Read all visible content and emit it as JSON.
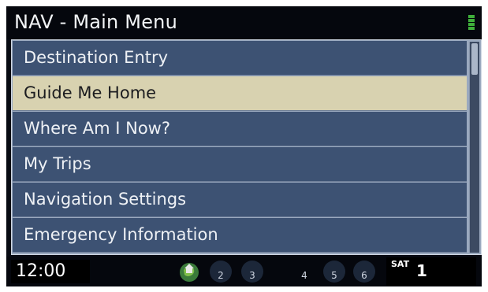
{
  "header": {
    "title": "NAV - Main Menu",
    "status_icon": "signal-strength-icon"
  },
  "menu": {
    "items": [
      {
        "label": "Destination Entry",
        "selected": false
      },
      {
        "label": "Guide Me Home",
        "selected": true
      },
      {
        "label": "Where Am I Now?",
        "selected": false
      },
      {
        "label": "My Trips",
        "selected": false
      },
      {
        "label": "Navigation Settings",
        "selected": false
      },
      {
        "label": "Emergency Information",
        "selected": false
      }
    ]
  },
  "statusbar": {
    "time": "12:00",
    "presets": [
      "2",
      "3",
      "4",
      "5",
      "6"
    ],
    "source_label": "SAT",
    "channel": "1"
  },
  "colors": {
    "item_bg": "#3d5273",
    "selected_bg": "#d8d2b0",
    "accent_green": "#3fae3a"
  }
}
